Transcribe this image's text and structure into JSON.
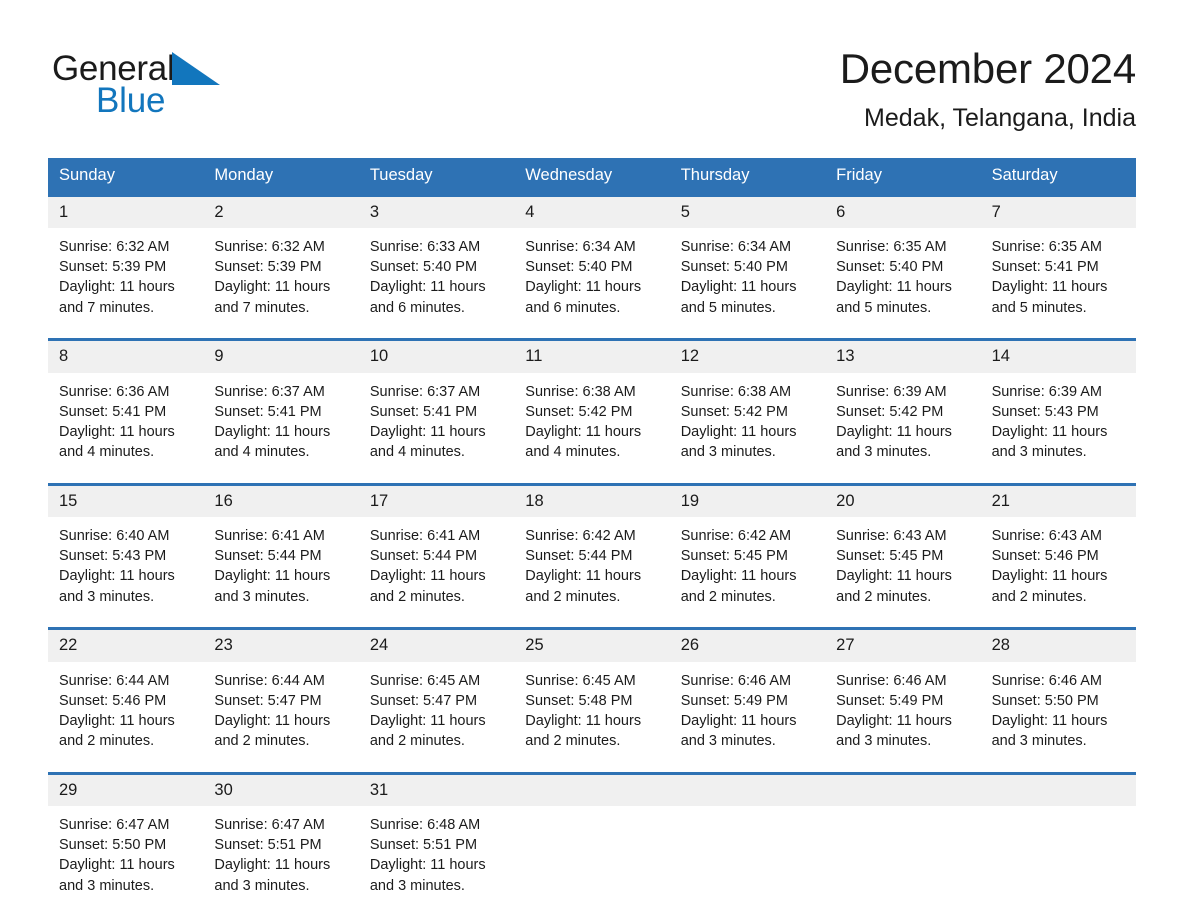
{
  "brand": {
    "name_part1": "General",
    "name_part2": "Blue",
    "triangle_color": "#1276bd",
    "accent_color": "#2e72b4"
  },
  "header": {
    "title": "December 2024",
    "subtitle": "Medak, Telangana, India"
  },
  "calendar": {
    "weekday_headers": [
      "Sunday",
      "Monday",
      "Tuesday",
      "Wednesday",
      "Thursday",
      "Friday",
      "Saturday"
    ],
    "weeks": [
      {
        "days": [
          {
            "num": "1",
            "l1": "Sunrise: 6:32 AM",
            "l2": "Sunset: 5:39 PM",
            "l3": "Daylight: 11 hours",
            "l4": "and 7 minutes."
          },
          {
            "num": "2",
            "l1": "Sunrise: 6:32 AM",
            "l2": "Sunset: 5:39 PM",
            "l3": "Daylight: 11 hours",
            "l4": "and 7 minutes."
          },
          {
            "num": "3",
            "l1": "Sunrise: 6:33 AM",
            "l2": "Sunset: 5:40 PM",
            "l3": "Daylight: 11 hours",
            "l4": "and 6 minutes."
          },
          {
            "num": "4",
            "l1": "Sunrise: 6:34 AM",
            "l2": "Sunset: 5:40 PM",
            "l3": "Daylight: 11 hours",
            "l4": "and 6 minutes."
          },
          {
            "num": "5",
            "l1": "Sunrise: 6:34 AM",
            "l2": "Sunset: 5:40 PM",
            "l3": "Daylight: 11 hours",
            "l4": "and 5 minutes."
          },
          {
            "num": "6",
            "l1": "Sunrise: 6:35 AM",
            "l2": "Sunset: 5:40 PM",
            "l3": "Daylight: 11 hours",
            "l4": "and 5 minutes."
          },
          {
            "num": "7",
            "l1": "Sunrise: 6:35 AM",
            "l2": "Sunset: 5:41 PM",
            "l3": "Daylight: 11 hours",
            "l4": "and 5 minutes."
          }
        ]
      },
      {
        "days": [
          {
            "num": "8",
            "l1": "Sunrise: 6:36 AM",
            "l2": "Sunset: 5:41 PM",
            "l3": "Daylight: 11 hours",
            "l4": "and 4 minutes."
          },
          {
            "num": "9",
            "l1": "Sunrise: 6:37 AM",
            "l2": "Sunset: 5:41 PM",
            "l3": "Daylight: 11 hours",
            "l4": "and 4 minutes."
          },
          {
            "num": "10",
            "l1": "Sunrise: 6:37 AM",
            "l2": "Sunset: 5:41 PM",
            "l3": "Daylight: 11 hours",
            "l4": "and 4 minutes."
          },
          {
            "num": "11",
            "l1": "Sunrise: 6:38 AM",
            "l2": "Sunset: 5:42 PM",
            "l3": "Daylight: 11 hours",
            "l4": "and 4 minutes."
          },
          {
            "num": "12",
            "l1": "Sunrise: 6:38 AM",
            "l2": "Sunset: 5:42 PM",
            "l3": "Daylight: 11 hours",
            "l4": "and 3 minutes."
          },
          {
            "num": "13",
            "l1": "Sunrise: 6:39 AM",
            "l2": "Sunset: 5:42 PM",
            "l3": "Daylight: 11 hours",
            "l4": "and 3 minutes."
          },
          {
            "num": "14",
            "l1": "Sunrise: 6:39 AM",
            "l2": "Sunset: 5:43 PM",
            "l3": "Daylight: 11 hours",
            "l4": "and 3 minutes."
          }
        ]
      },
      {
        "days": [
          {
            "num": "15",
            "l1": "Sunrise: 6:40 AM",
            "l2": "Sunset: 5:43 PM",
            "l3": "Daylight: 11 hours",
            "l4": "and 3 minutes."
          },
          {
            "num": "16",
            "l1": "Sunrise: 6:41 AM",
            "l2": "Sunset: 5:44 PM",
            "l3": "Daylight: 11 hours",
            "l4": "and 3 minutes."
          },
          {
            "num": "17",
            "l1": "Sunrise: 6:41 AM",
            "l2": "Sunset: 5:44 PM",
            "l3": "Daylight: 11 hours",
            "l4": "and 2 minutes."
          },
          {
            "num": "18",
            "l1": "Sunrise: 6:42 AM",
            "l2": "Sunset: 5:44 PM",
            "l3": "Daylight: 11 hours",
            "l4": "and 2 minutes."
          },
          {
            "num": "19",
            "l1": "Sunrise: 6:42 AM",
            "l2": "Sunset: 5:45 PM",
            "l3": "Daylight: 11 hours",
            "l4": "and 2 minutes."
          },
          {
            "num": "20",
            "l1": "Sunrise: 6:43 AM",
            "l2": "Sunset: 5:45 PM",
            "l3": "Daylight: 11 hours",
            "l4": "and 2 minutes."
          },
          {
            "num": "21",
            "l1": "Sunrise: 6:43 AM",
            "l2": "Sunset: 5:46 PM",
            "l3": "Daylight: 11 hours",
            "l4": "and 2 minutes."
          }
        ]
      },
      {
        "days": [
          {
            "num": "22",
            "l1": "Sunrise: 6:44 AM",
            "l2": "Sunset: 5:46 PM",
            "l3": "Daylight: 11 hours",
            "l4": "and 2 minutes."
          },
          {
            "num": "23",
            "l1": "Sunrise: 6:44 AM",
            "l2": "Sunset: 5:47 PM",
            "l3": "Daylight: 11 hours",
            "l4": "and 2 minutes."
          },
          {
            "num": "24",
            "l1": "Sunrise: 6:45 AM",
            "l2": "Sunset: 5:47 PM",
            "l3": "Daylight: 11 hours",
            "l4": "and 2 minutes."
          },
          {
            "num": "25",
            "l1": "Sunrise: 6:45 AM",
            "l2": "Sunset: 5:48 PM",
            "l3": "Daylight: 11 hours",
            "l4": "and 2 minutes."
          },
          {
            "num": "26",
            "l1": "Sunrise: 6:46 AM",
            "l2": "Sunset: 5:49 PM",
            "l3": "Daylight: 11 hours",
            "l4": "and 3 minutes."
          },
          {
            "num": "27",
            "l1": "Sunrise: 6:46 AM",
            "l2": "Sunset: 5:49 PM",
            "l3": "Daylight: 11 hours",
            "l4": "and 3 minutes."
          },
          {
            "num": "28",
            "l1": "Sunrise: 6:46 AM",
            "l2": "Sunset: 5:50 PM",
            "l3": "Daylight: 11 hours",
            "l4": "and 3 minutes."
          }
        ]
      },
      {
        "days": [
          {
            "num": "29",
            "l1": "Sunrise: 6:47 AM",
            "l2": "Sunset: 5:50 PM",
            "l3": "Daylight: 11 hours",
            "l4": "and 3 minutes."
          },
          {
            "num": "30",
            "l1": "Sunrise: 6:47 AM",
            "l2": "Sunset: 5:51 PM",
            "l3": "Daylight: 11 hours",
            "l4": "and 3 minutes."
          },
          {
            "num": "31",
            "l1": "Sunrise: 6:48 AM",
            "l2": "Sunset: 5:51 PM",
            "l3": "Daylight: 11 hours",
            "l4": "and 3 minutes."
          },
          {
            "num": "",
            "l1": "",
            "l2": "",
            "l3": "",
            "l4": ""
          },
          {
            "num": "",
            "l1": "",
            "l2": "",
            "l3": "",
            "l4": ""
          },
          {
            "num": "",
            "l1": "",
            "l2": "",
            "l3": "",
            "l4": ""
          },
          {
            "num": "",
            "l1": "",
            "l2": "",
            "l3": "",
            "l4": ""
          }
        ]
      }
    ]
  }
}
